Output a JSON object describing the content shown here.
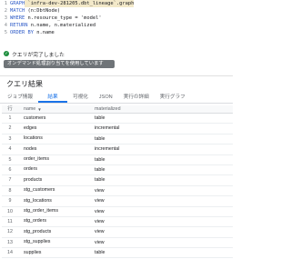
{
  "editor": {
    "lines": [
      {
        "num": "1",
        "kw": "GRAPH",
        "rest": " `infra-dev-281205.dbt_lineage`.graph"
      },
      {
        "num": "2",
        "kw": "MATCH",
        "rest": " (n:DbtNode)"
      },
      {
        "num": "3",
        "kw": "WHERE",
        "rest": " n.resource_type = 'model'"
      },
      {
        "num": "4",
        "kw": "RETURN",
        "rest": " n.name, n.materialized"
      },
      {
        "num": "5",
        "kw": "ORDER BY",
        "rest": " n.name"
      }
    ]
  },
  "status": {
    "message": "クエリが完了しました",
    "banner": "オンデマンド処理割り当てを使用しています"
  },
  "results": {
    "title": "クエリ結果",
    "tabs": [
      "ジョブ情報",
      "結果",
      "可視化",
      "JSON",
      "実行の詳細",
      "実行グラフ"
    ],
    "active_tab": "結果",
    "columns": [
      "行",
      "name",
      "materialized"
    ],
    "rows": [
      {
        "idx": "1",
        "name": "customers",
        "mat": "table"
      },
      {
        "idx": "2",
        "name": "edges",
        "mat": "incremental"
      },
      {
        "idx": "3",
        "name": "locations",
        "mat": "table"
      },
      {
        "idx": "4",
        "name": "nodes",
        "mat": "incremental"
      },
      {
        "idx": "5",
        "name": "order_items",
        "mat": "table"
      },
      {
        "idx": "6",
        "name": "orders",
        "mat": "table"
      },
      {
        "idx": "7",
        "name": "products",
        "mat": "table"
      },
      {
        "idx": "8",
        "name": "stg_customers",
        "mat": "view"
      },
      {
        "idx": "9",
        "name": "stg_locations",
        "mat": "view"
      },
      {
        "idx": "10",
        "name": "stg_order_items",
        "mat": "view"
      },
      {
        "idx": "11",
        "name": "stg_orders",
        "mat": "view"
      },
      {
        "idx": "12",
        "name": "stg_products",
        "mat": "view"
      },
      {
        "idx": "13",
        "name": "stg_supplies",
        "mat": "view"
      },
      {
        "idx": "14",
        "name": "supplies",
        "mat": "table"
      }
    ]
  },
  "colors": {
    "accent": "#1a73e8",
    "success": "#1e8e3e",
    "banner_bg": "#6f7478",
    "keyword": "#2f5cc8"
  }
}
